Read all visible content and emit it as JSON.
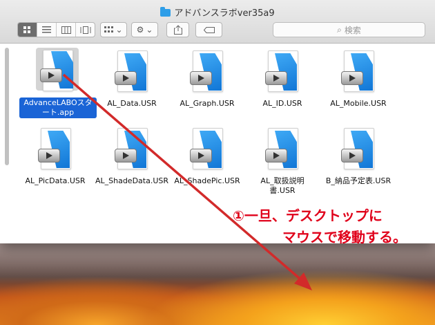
{
  "window": {
    "title": "アドバンスラボver35a9"
  },
  "toolbar": {
    "views": [
      "icon-view",
      "list-view",
      "column-view",
      "gallery-view"
    ],
    "arrange_icon": "grid-icon",
    "action_icon": "gear-icon",
    "share_icon": "share-icon",
    "tag_icon": "tag-icon",
    "chevron": "⌄",
    "search_placeholder": "検索"
  },
  "files": [
    {
      "name": "AdvanceLABOスタート.app",
      "selected": true
    },
    {
      "name": "AL_Data.USR",
      "selected": false
    },
    {
      "name": "AL_Graph.USR",
      "selected": false
    },
    {
      "name": "AL_ID.USR",
      "selected": false
    },
    {
      "name": "AL_Mobile.USR",
      "selected": false
    },
    {
      "name": "AL_PicData.USR",
      "selected": false
    },
    {
      "name": "AL_ShadeData.USR",
      "selected": false
    },
    {
      "name": "AL_ShadePic.USR",
      "selected": false
    },
    {
      "name": "AL_取扱説明書.USR",
      "selected": false
    },
    {
      "name": "B_納品予定表.USR",
      "selected": false
    }
  ],
  "annotation": {
    "line1": "①一旦、デスクトップに",
    "line2": "マウスで移動する。",
    "color": "#e0001a"
  }
}
